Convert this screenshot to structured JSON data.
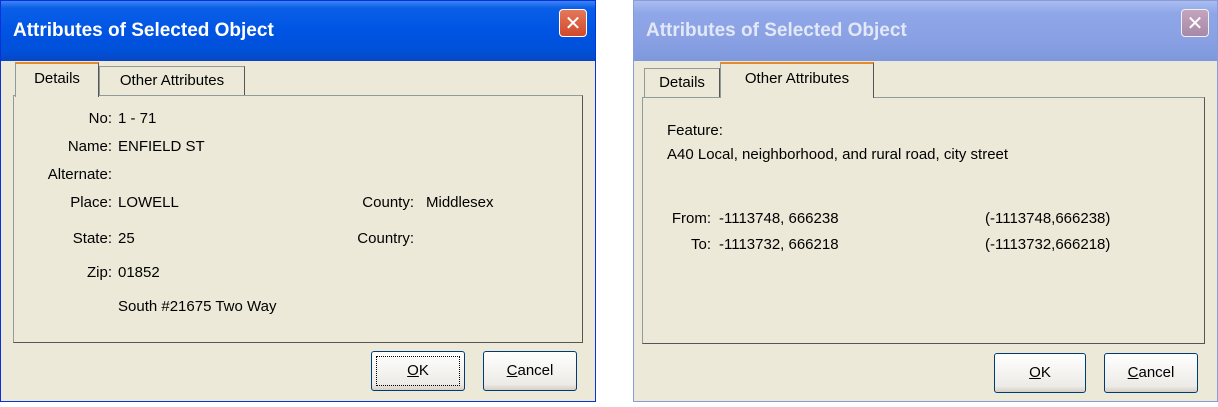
{
  "left_window": {
    "title": "Attributes of Selected Object",
    "close_glyph": "✕",
    "tabs": [
      "Details",
      "Other Attributes"
    ],
    "active_tab": "Details",
    "fields": {
      "no_label": "No:",
      "no_value": "1 - 71",
      "name_label": "Name:",
      "name_value": "ENFIELD ST",
      "alternate_label": "Alternate:",
      "place_label": "Place:",
      "place_value": "LOWELL",
      "county_label": "County:",
      "county_value": "Middlesex",
      "state_label": "State:",
      "state_value": "25",
      "country_label": "Country:",
      "zip_label": "Zip:",
      "zip_value": "01852",
      "direction_text": "South #21675 Two Way"
    },
    "ok_label": {
      "accel": "O",
      "rest": "K"
    },
    "cancel_label": {
      "accel": "C",
      "rest": "ancel"
    }
  },
  "right_window": {
    "title": "Attributes of Selected Object",
    "close_glyph": "✕",
    "tabs": [
      "Details",
      "Other Attributes"
    ],
    "active_tab": "Other Attributes",
    "feature_label": "Feature:",
    "feature_value": "A40  Local, neighborhood, and rural road, city street",
    "from_label": "From:",
    "from_value": "-1113748, 666238",
    "from_paren": "(-1113748,666238)",
    "to_label": "To:",
    "to_value": "-1113732, 666218",
    "to_paren": "(-1113732,666218)",
    "ok_label": {
      "accel": "O",
      "rest": "K"
    },
    "cancel_label": {
      "accel": "C",
      "rest": "ancel"
    }
  },
  "colors": {
    "title_active": "#0054e3",
    "title_inactive": "#8aa2e4",
    "dialog_bg": "#ece9d8",
    "close_active": "#d9573a"
  }
}
